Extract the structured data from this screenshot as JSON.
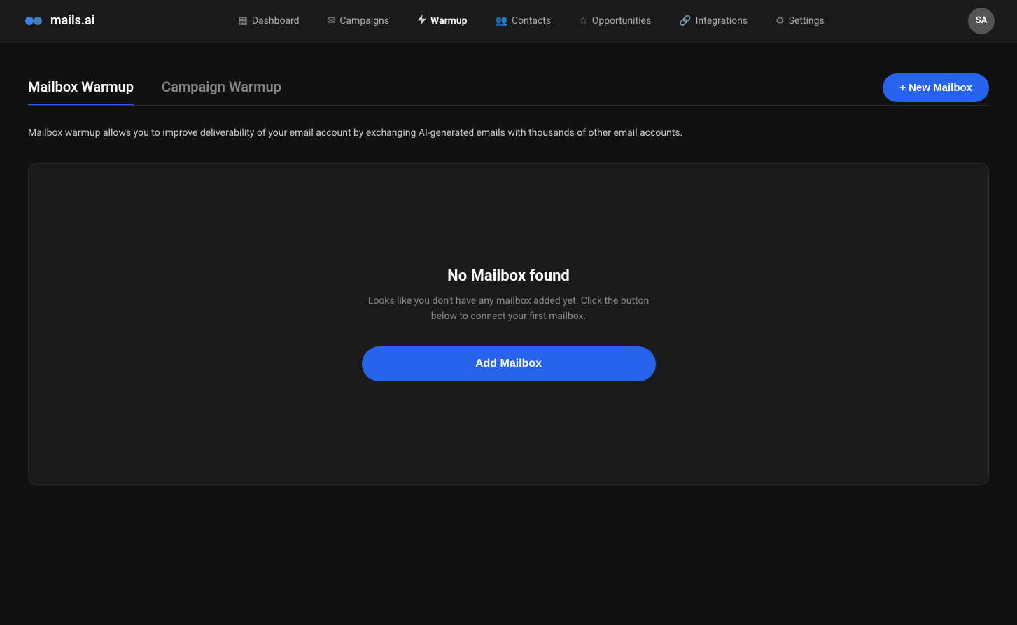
{
  "app": {
    "logo_text": "mails.ai",
    "avatar_initials": "SA"
  },
  "nav": {
    "items": [
      {
        "id": "dashboard",
        "label": "Dashboard",
        "icon": "grid-icon",
        "active": false
      },
      {
        "id": "campaigns",
        "label": "Campaigns",
        "icon": "email-icon",
        "active": false
      },
      {
        "id": "warmup",
        "label": "Warmup",
        "icon": "lightning-icon",
        "active": true
      },
      {
        "id": "contacts",
        "label": "Contacts",
        "icon": "contacts-icon",
        "active": false
      },
      {
        "id": "opportunities",
        "label": "Opportunities",
        "icon": "star-icon",
        "active": false
      },
      {
        "id": "integrations",
        "label": "Integrations",
        "icon": "link-icon",
        "active": false
      },
      {
        "id": "settings",
        "label": "Settings",
        "icon": "gear-icon",
        "active": false
      }
    ]
  },
  "page": {
    "tabs": [
      {
        "id": "mailbox-warmup",
        "label": "Mailbox Warmup",
        "active": true
      },
      {
        "id": "campaign-warmup",
        "label": "Campaign Warmup",
        "active": false
      }
    ],
    "new_mailbox_button": "+ New Mailbox",
    "description": "Mailbox warmup allows you to improve deliverability of your email account by exchanging AI-generated emails with thousands of other email accounts.",
    "empty_state": {
      "title": "No Mailbox found",
      "subtitle": "Looks like you don't have any mailbox added yet. Click the button below to connect your first mailbox.",
      "add_button": "Add Mailbox"
    }
  }
}
